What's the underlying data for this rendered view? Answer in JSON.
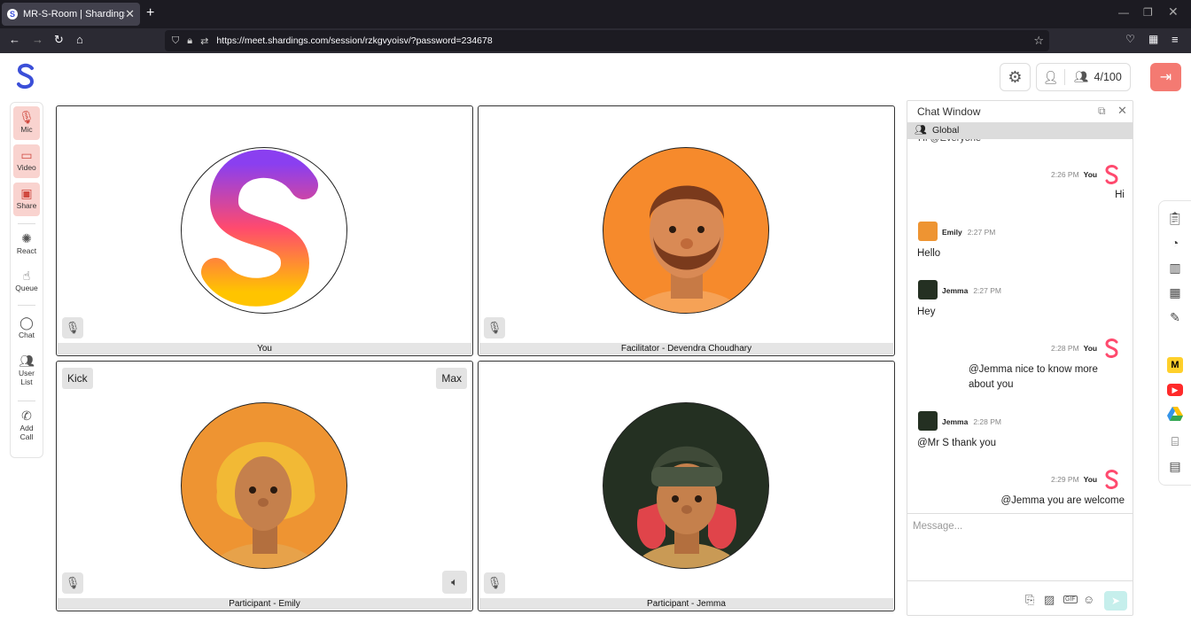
{
  "browser": {
    "tab_title": "MR-S-Room | Shardings",
    "url": "https://meet.shardings.com/session/rzkgvyoisv/?password=234678"
  },
  "header": {
    "participant_count": "4/100"
  },
  "left_toolbar": {
    "mic": "Mic",
    "video": "Video",
    "share": "Share",
    "react": "React",
    "queue": "Queue",
    "chat": "Chat",
    "user_list_1": "User",
    "user_list_2": "List",
    "add_call_1": "Add",
    "add_call_2": "Call"
  },
  "tiles": [
    {
      "label": "You"
    },
    {
      "label": "Facilitator - Devendra Choudhary"
    },
    {
      "label": "Participant - Emily",
      "kick": "Kick",
      "max": "Max"
    },
    {
      "label": "Participant - Jemma"
    }
  ],
  "chat": {
    "title": "Chat Window",
    "channel": "Global",
    "partial_top": "Hi @Everyone",
    "messages": [
      {
        "sender": "You",
        "time": "2:26 PM",
        "text": "Hi"
      },
      {
        "sender": "Emily",
        "time": "2:27 PM",
        "text": "Hello"
      },
      {
        "sender": "Jemma",
        "time": "2:27 PM",
        "text": "Hey"
      },
      {
        "sender": "You",
        "time": "2:28 PM",
        "text_1": "@Jemma nice to know more",
        "text_2": "about you"
      },
      {
        "sender": "Jemma",
        "time": "2:28 PM",
        "text": "@Mr S thank you"
      },
      {
        "sender": "You",
        "time": "2:29 PM",
        "text": "@Jemma you are welcome"
      }
    ],
    "input_placeholder": "Message...",
    "gif_label": "GIF"
  },
  "colors": {
    "accent_red": "#f47a72",
    "brand_blue": "#3b4fd8",
    "send_teal": "#c6efec"
  }
}
